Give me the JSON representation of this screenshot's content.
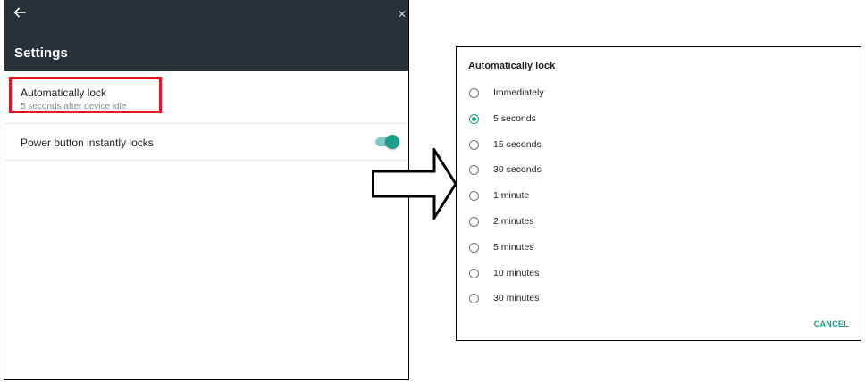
{
  "settings": {
    "title": "Settings",
    "back_icon": "arrow-left-icon",
    "close_icon": "close-icon",
    "items": [
      {
        "title": "Automatically lock",
        "summary": "5 seconds after device idle"
      },
      {
        "title": "Power button instantly locks",
        "toggle_on": true
      }
    ]
  },
  "dialog": {
    "title": "Automatically lock",
    "options": [
      {
        "label": "Immediately",
        "checked": false
      },
      {
        "label": "5 seconds",
        "checked": true
      },
      {
        "label": "15 seconds",
        "checked": false
      },
      {
        "label": "30 seconds",
        "checked": false
      },
      {
        "label": "1 minute",
        "checked": false
      },
      {
        "label": "2 minutes",
        "checked": false
      },
      {
        "label": "5 minutes",
        "checked": false
      },
      {
        "label": "10 minutes",
        "checked": false
      },
      {
        "label": "30 minutes",
        "checked": false
      }
    ],
    "cancel_label": "CANCEL"
  },
  "colors": {
    "appbar": "#263238",
    "accent": "#1a9f8a",
    "highlight": "#e8131f"
  }
}
